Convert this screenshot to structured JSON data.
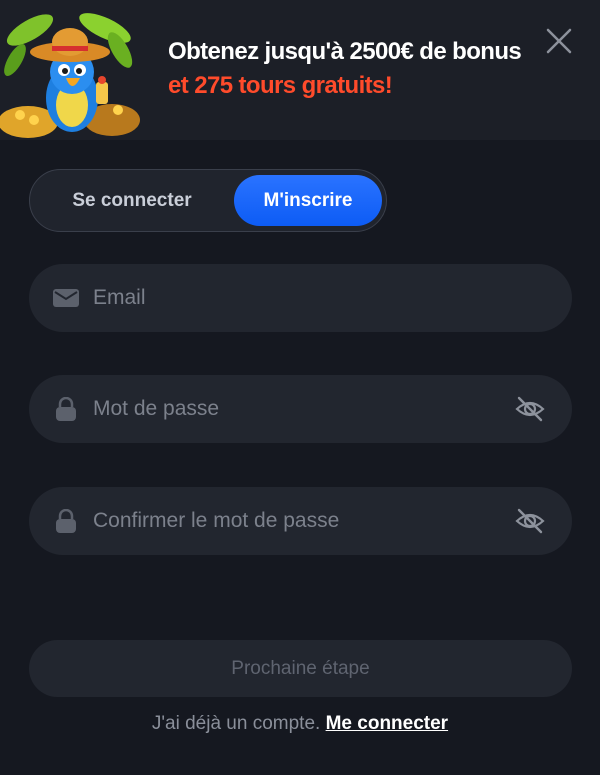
{
  "banner": {
    "line1": "Obtenez jusqu'à 2500€ de bonus",
    "line2": "et 275 tours gratuits!"
  },
  "tabs": {
    "login": "Se connecter",
    "register": "M'inscrire",
    "active": "register"
  },
  "form": {
    "email_placeholder": "Email",
    "password_placeholder": "Mot de passe",
    "confirm_placeholder": "Confirmer le mot de passe",
    "next_label": "Prochaine étape"
  },
  "footer": {
    "text": "J'ai déjà un compte.",
    "link": "Me connecter"
  },
  "colors": {
    "accent_blue": "#1466ff",
    "promo_red": "#ff4b2b",
    "background": "#151820"
  },
  "icons": [
    "parrot-mascot-icon",
    "close-icon",
    "mail-icon",
    "lock-icon",
    "eye-off-icon"
  ]
}
